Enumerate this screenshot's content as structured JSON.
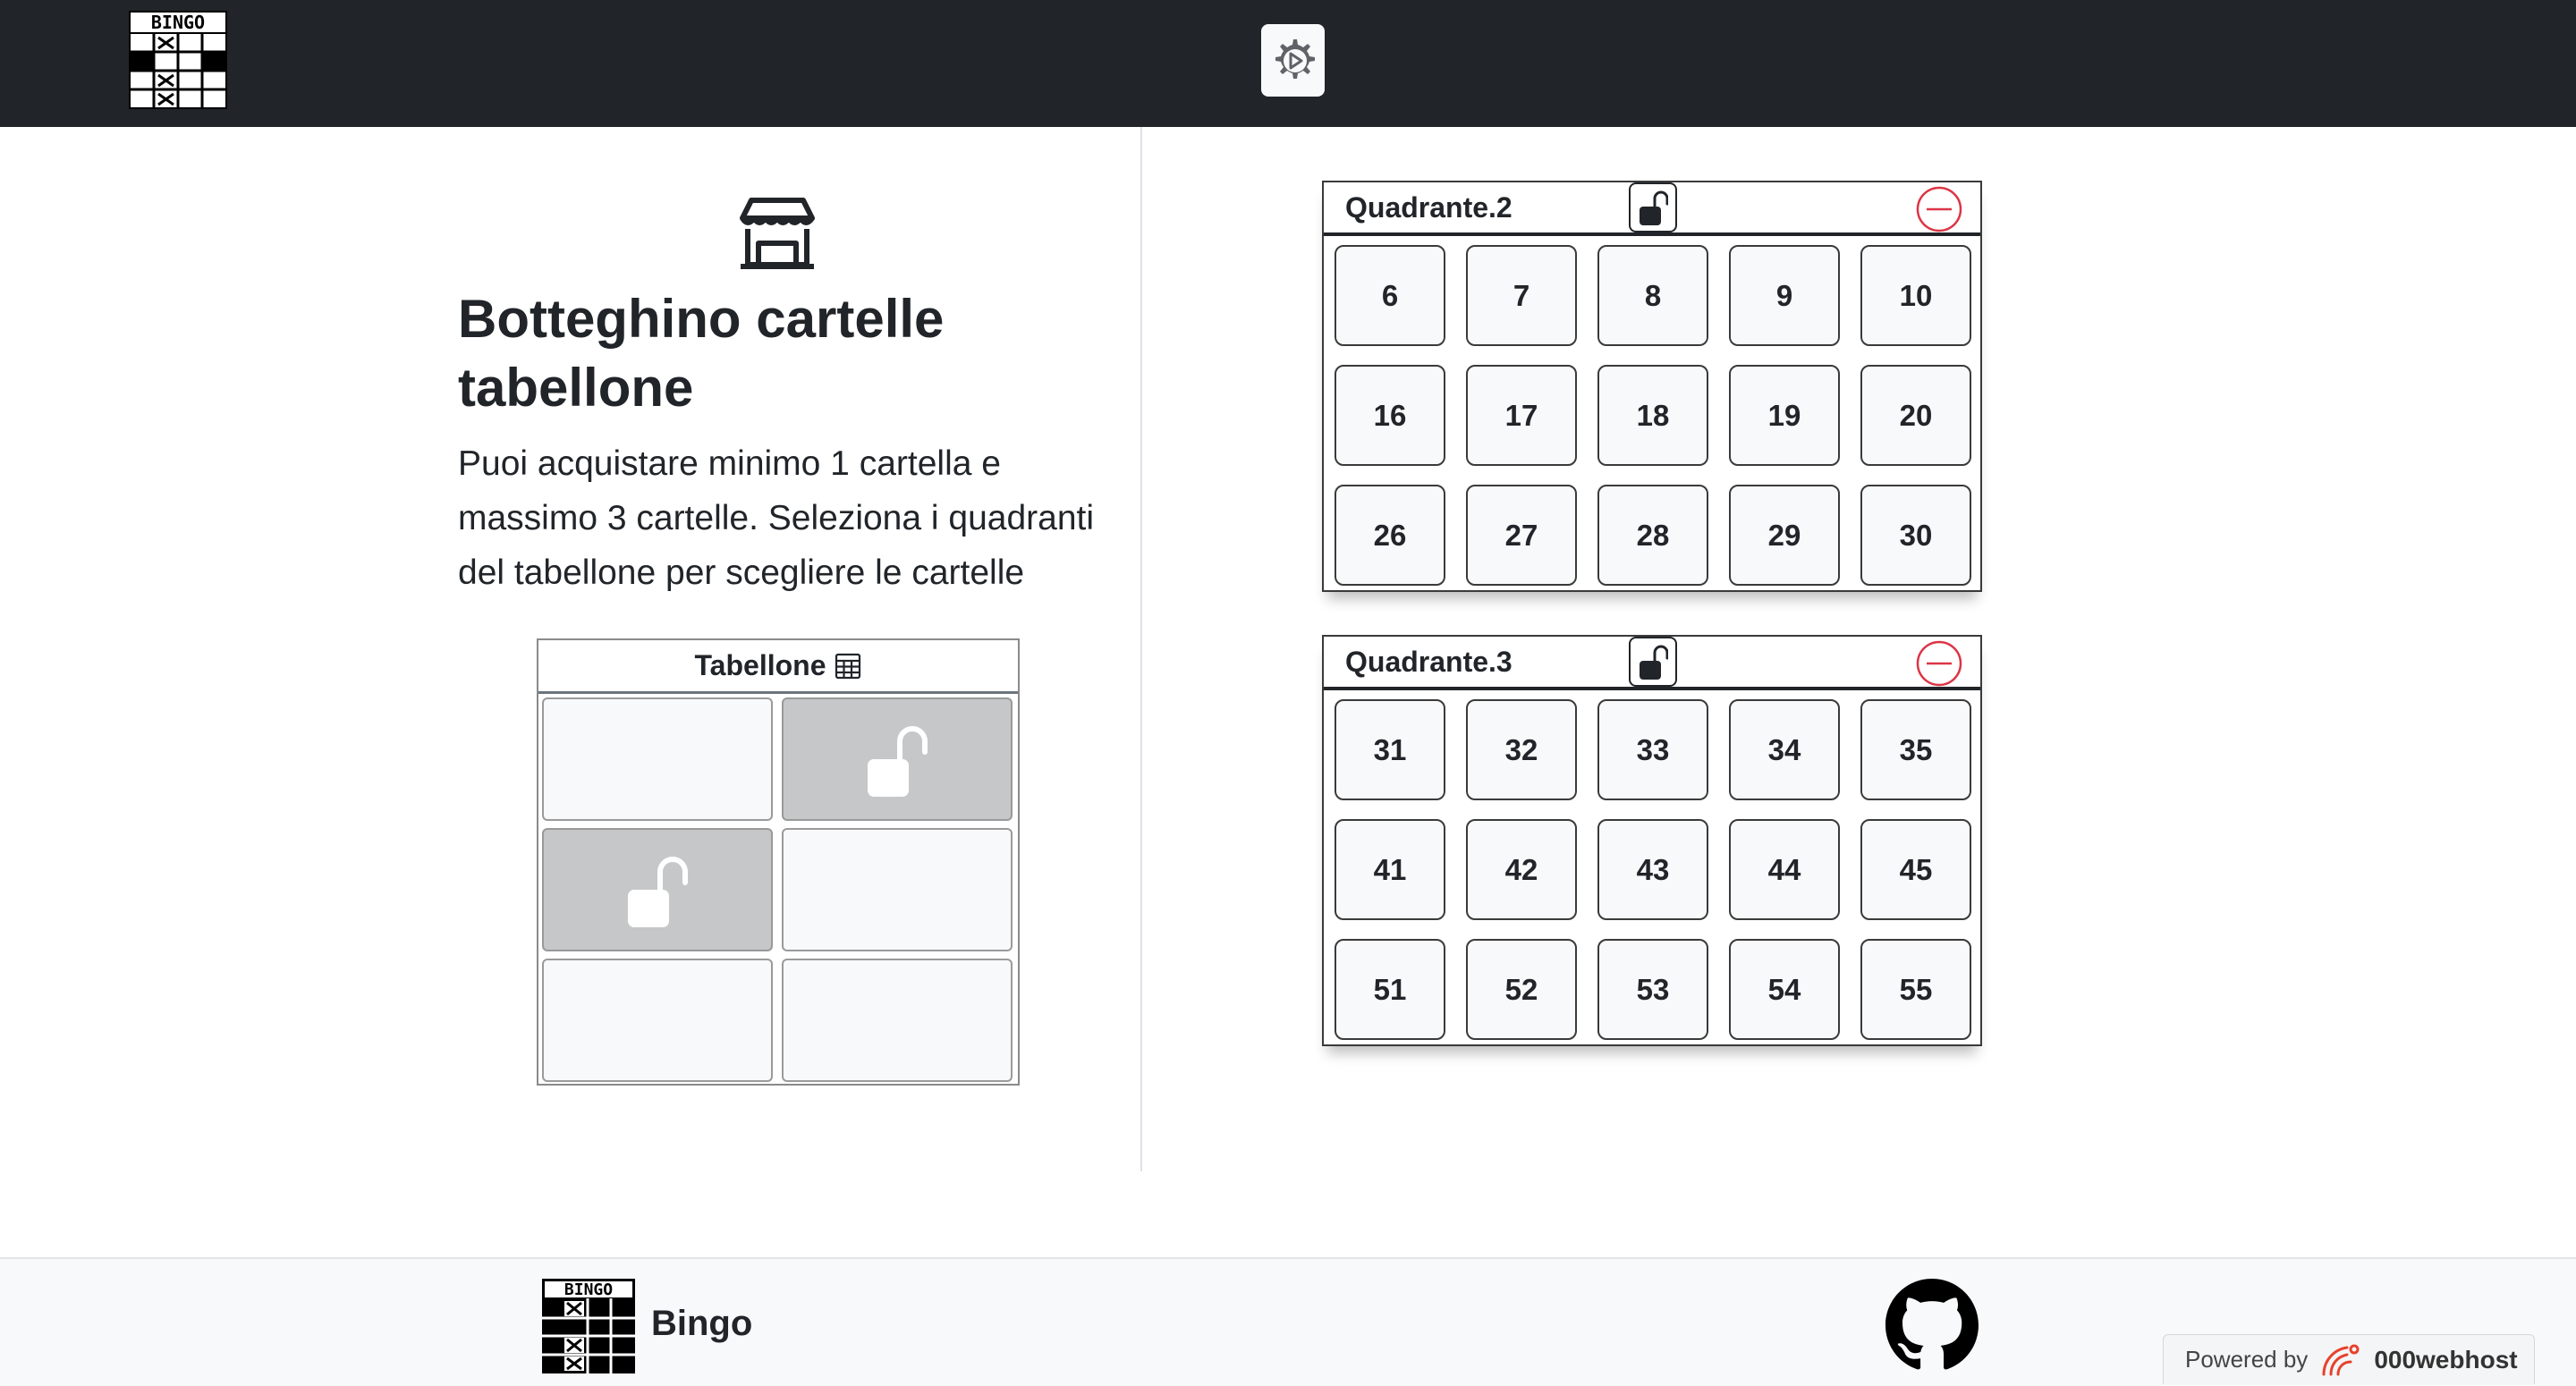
{
  "navbar": {
    "logo_text": "BINGO",
    "settings_icon": "gear-play-icon"
  },
  "main": {
    "icon": "shop-icon",
    "title": "Botteghino cartelle tabellone",
    "lead": "Puoi acquistare minimo 1 cartella e massimo 3 cartelle. Seleziona i quadranti del tabellone per scegliere le cartelle"
  },
  "board": {
    "title": "Tabellone",
    "title_icon": "table-icon",
    "cells": [
      {
        "selected": false
      },
      {
        "selected": true
      },
      {
        "selected": true
      },
      {
        "selected": false
      },
      {
        "selected": false
      },
      {
        "selected": false
      }
    ]
  },
  "quadrants": [
    {
      "title": "Quadrante.2",
      "numbers": [
        "6",
        "7",
        "8",
        "9",
        "10",
        "16",
        "17",
        "18",
        "19",
        "20",
        "26",
        "27",
        "28",
        "29",
        "30"
      ]
    },
    {
      "title": "Quadrante.3",
      "numbers": [
        "31",
        "32",
        "33",
        "34",
        "35",
        "41",
        "42",
        "43",
        "44",
        "45",
        "51",
        "52",
        "53",
        "54",
        "55"
      ]
    }
  ],
  "footer": {
    "logo_text": "BINGO",
    "brand": "Bingo",
    "powered_label": "Powered by",
    "powered_brand": "000webhost"
  },
  "colors": {
    "navbar_bg": "#212529",
    "selected_cell": "#c6c7c8",
    "remove_red": "#dc3545"
  }
}
